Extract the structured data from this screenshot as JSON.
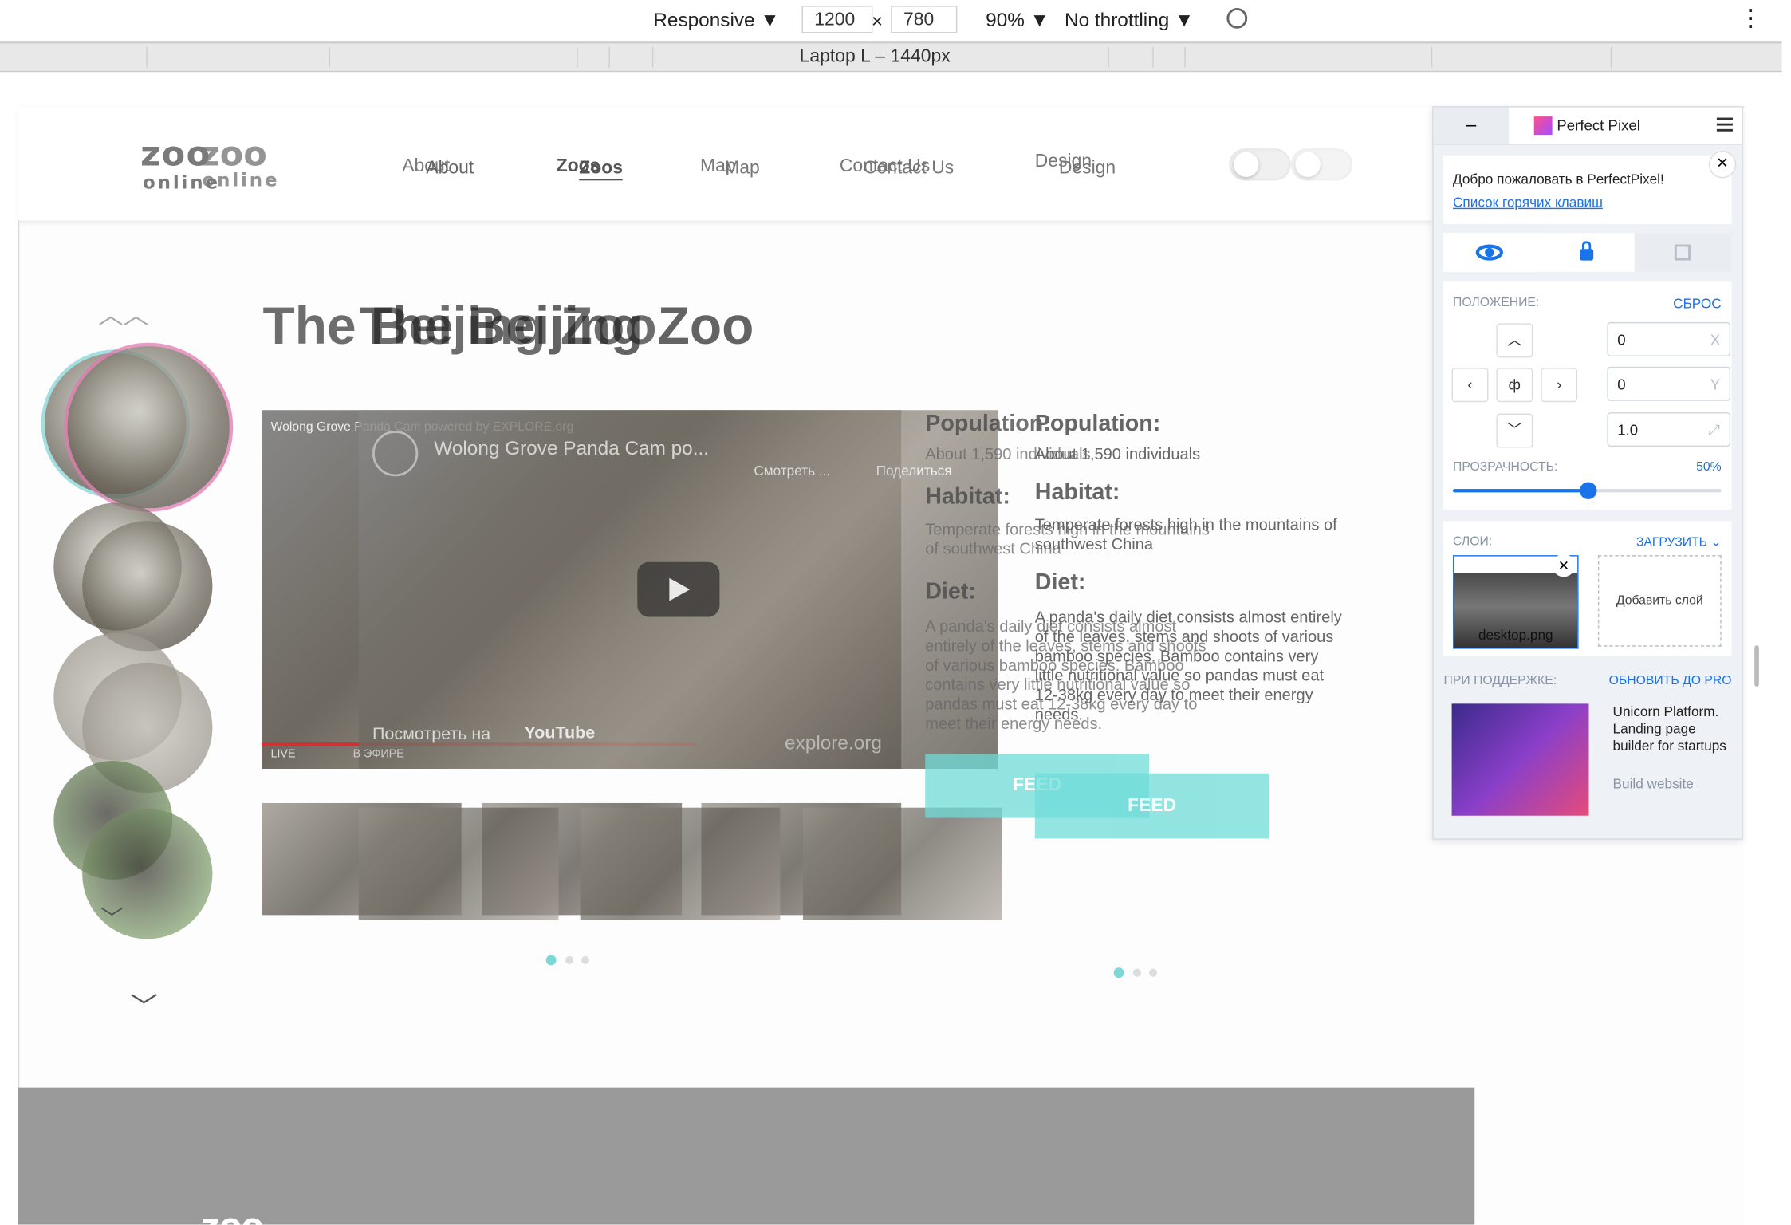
{
  "devtools": {
    "device": "Responsive ▼",
    "width": "1200",
    "times": "×",
    "height": "780",
    "zoom": "90% ▼",
    "throttling": "No throttling ▼",
    "ruler_label": "Laptop L – 1440px"
  },
  "site": {
    "logo_top": "zoo",
    "logo_bottom": "online",
    "nav": [
      "About",
      "Zoos",
      "Map",
      "Contact Us",
      "Design"
    ],
    "title": "The Beijing Zoo",
    "video_title": "Wolong Grove Panda Cam po...",
    "video_title_small": "Wolong Grove Panda Cam powered by EXPLORE.org",
    "watch_later": "Смотреть ...",
    "share": "Поделиться",
    "watch_on": "Посмотреть на",
    "youtube": "YouTube",
    "live": "LIVE",
    "live_ru": "В ЭФИРЕ",
    "explore": "explore.org",
    "population_head": "Population:",
    "population_text": "About 1,590 individuals",
    "habitat_head": "Habitat:",
    "habitat_text": "Temperate forests high in the mountains of southwest China",
    "diet_head": "Diet:",
    "diet_text": "A panda's daily diet consists almost entirely of the leaves, stems and shoots of various bamboo species. Bamboo contains very little nutritional value so pandas must eat 12-38kg every day to meet their energy needs.",
    "feed": "FEED",
    "footer_logo": "zoo"
  },
  "perfect_pixel": {
    "minimize": "–",
    "brand": "Perfect Pixel",
    "welcome": "Добро пожаловать в PerfectPixel!",
    "hotkeys": "Список горячих клавиш",
    "position_label": "ПОЛОЖЕНИЕ:",
    "reset": "СБРОС",
    "x_value": "0",
    "x_suffix": "X",
    "y_value": "0",
    "y_suffix": "Y",
    "scale_value": "1.0",
    "center_glyph": "ф",
    "opacity_label": "ПРОЗРАЧНОСТЬ:",
    "opacity_value": "50%",
    "opacity": 0.5,
    "layers_label": "СЛОИ:",
    "upload": "ЗАГРУЗИТЬ",
    "layer_name": "desktop.png",
    "add_layer": "Добавить слой",
    "support_label": "ПРИ ПОДДЕРЖКЕ:",
    "upgrade": "ОБНОВИТЬ ДО PRO",
    "ad_title": "Unicorn Platform. Landing page builder for startups",
    "ad_cta": "Build website"
  },
  "colors": {
    "accent": "#1a73e8",
    "feed": "#6fdcd8",
    "footer": "#9a9a9a"
  }
}
